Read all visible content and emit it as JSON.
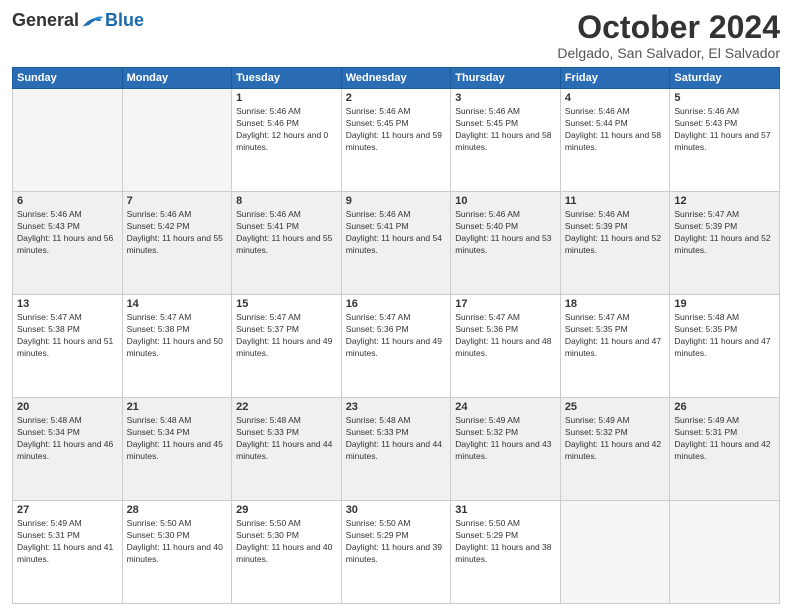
{
  "logo": {
    "general": "General",
    "blue": "Blue"
  },
  "header": {
    "month": "October 2024",
    "location": "Delgado, San Salvador, El Salvador"
  },
  "weekdays": [
    "Sunday",
    "Monday",
    "Tuesday",
    "Wednesday",
    "Thursday",
    "Friday",
    "Saturday"
  ],
  "weeks": [
    [
      {
        "day": "",
        "sunrise": "",
        "sunset": "",
        "daylight": "",
        "empty": true
      },
      {
        "day": "",
        "sunrise": "",
        "sunset": "",
        "daylight": "",
        "empty": true
      },
      {
        "day": "1",
        "sunrise": "Sunrise: 5:46 AM",
        "sunset": "Sunset: 5:46 PM",
        "daylight": "Daylight: 12 hours and 0 minutes."
      },
      {
        "day": "2",
        "sunrise": "Sunrise: 5:46 AM",
        "sunset": "Sunset: 5:45 PM",
        "daylight": "Daylight: 11 hours and 59 minutes."
      },
      {
        "day": "3",
        "sunrise": "Sunrise: 5:46 AM",
        "sunset": "Sunset: 5:45 PM",
        "daylight": "Daylight: 11 hours and 58 minutes."
      },
      {
        "day": "4",
        "sunrise": "Sunrise: 5:46 AM",
        "sunset": "Sunset: 5:44 PM",
        "daylight": "Daylight: 11 hours and 58 minutes."
      },
      {
        "day": "5",
        "sunrise": "Sunrise: 5:46 AM",
        "sunset": "Sunset: 5:43 PM",
        "daylight": "Daylight: 11 hours and 57 minutes."
      }
    ],
    [
      {
        "day": "6",
        "sunrise": "Sunrise: 5:46 AM",
        "sunset": "Sunset: 5:43 PM",
        "daylight": "Daylight: 11 hours and 56 minutes."
      },
      {
        "day": "7",
        "sunrise": "Sunrise: 5:46 AM",
        "sunset": "Sunset: 5:42 PM",
        "daylight": "Daylight: 11 hours and 55 minutes."
      },
      {
        "day": "8",
        "sunrise": "Sunrise: 5:46 AM",
        "sunset": "Sunset: 5:41 PM",
        "daylight": "Daylight: 11 hours and 55 minutes."
      },
      {
        "day": "9",
        "sunrise": "Sunrise: 5:46 AM",
        "sunset": "Sunset: 5:41 PM",
        "daylight": "Daylight: 11 hours and 54 minutes."
      },
      {
        "day": "10",
        "sunrise": "Sunrise: 5:46 AM",
        "sunset": "Sunset: 5:40 PM",
        "daylight": "Daylight: 11 hours and 53 minutes."
      },
      {
        "day": "11",
        "sunrise": "Sunrise: 5:46 AM",
        "sunset": "Sunset: 5:39 PM",
        "daylight": "Daylight: 11 hours and 52 minutes."
      },
      {
        "day": "12",
        "sunrise": "Sunrise: 5:47 AM",
        "sunset": "Sunset: 5:39 PM",
        "daylight": "Daylight: 11 hours and 52 minutes."
      }
    ],
    [
      {
        "day": "13",
        "sunrise": "Sunrise: 5:47 AM",
        "sunset": "Sunset: 5:38 PM",
        "daylight": "Daylight: 11 hours and 51 minutes."
      },
      {
        "day": "14",
        "sunrise": "Sunrise: 5:47 AM",
        "sunset": "Sunset: 5:38 PM",
        "daylight": "Daylight: 11 hours and 50 minutes."
      },
      {
        "day": "15",
        "sunrise": "Sunrise: 5:47 AM",
        "sunset": "Sunset: 5:37 PM",
        "daylight": "Daylight: 11 hours and 49 minutes."
      },
      {
        "day": "16",
        "sunrise": "Sunrise: 5:47 AM",
        "sunset": "Sunset: 5:36 PM",
        "daylight": "Daylight: 11 hours and 49 minutes."
      },
      {
        "day": "17",
        "sunrise": "Sunrise: 5:47 AM",
        "sunset": "Sunset: 5:36 PM",
        "daylight": "Daylight: 11 hours and 48 minutes."
      },
      {
        "day": "18",
        "sunrise": "Sunrise: 5:47 AM",
        "sunset": "Sunset: 5:35 PM",
        "daylight": "Daylight: 11 hours and 47 minutes."
      },
      {
        "day": "19",
        "sunrise": "Sunrise: 5:48 AM",
        "sunset": "Sunset: 5:35 PM",
        "daylight": "Daylight: 11 hours and 47 minutes."
      }
    ],
    [
      {
        "day": "20",
        "sunrise": "Sunrise: 5:48 AM",
        "sunset": "Sunset: 5:34 PM",
        "daylight": "Daylight: 11 hours and 46 minutes."
      },
      {
        "day": "21",
        "sunrise": "Sunrise: 5:48 AM",
        "sunset": "Sunset: 5:34 PM",
        "daylight": "Daylight: 11 hours and 45 minutes."
      },
      {
        "day": "22",
        "sunrise": "Sunrise: 5:48 AM",
        "sunset": "Sunset: 5:33 PM",
        "daylight": "Daylight: 11 hours and 44 minutes."
      },
      {
        "day": "23",
        "sunrise": "Sunrise: 5:48 AM",
        "sunset": "Sunset: 5:33 PM",
        "daylight": "Daylight: 11 hours and 44 minutes."
      },
      {
        "day": "24",
        "sunrise": "Sunrise: 5:49 AM",
        "sunset": "Sunset: 5:32 PM",
        "daylight": "Daylight: 11 hours and 43 minutes."
      },
      {
        "day": "25",
        "sunrise": "Sunrise: 5:49 AM",
        "sunset": "Sunset: 5:32 PM",
        "daylight": "Daylight: 11 hours and 42 minutes."
      },
      {
        "day": "26",
        "sunrise": "Sunrise: 5:49 AM",
        "sunset": "Sunset: 5:31 PM",
        "daylight": "Daylight: 11 hours and 42 minutes."
      }
    ],
    [
      {
        "day": "27",
        "sunrise": "Sunrise: 5:49 AM",
        "sunset": "Sunset: 5:31 PM",
        "daylight": "Daylight: 11 hours and 41 minutes."
      },
      {
        "day": "28",
        "sunrise": "Sunrise: 5:50 AM",
        "sunset": "Sunset: 5:30 PM",
        "daylight": "Daylight: 11 hours and 40 minutes."
      },
      {
        "day": "29",
        "sunrise": "Sunrise: 5:50 AM",
        "sunset": "Sunset: 5:30 PM",
        "daylight": "Daylight: 11 hours and 40 minutes."
      },
      {
        "day": "30",
        "sunrise": "Sunrise: 5:50 AM",
        "sunset": "Sunset: 5:29 PM",
        "daylight": "Daylight: 11 hours and 39 minutes."
      },
      {
        "day": "31",
        "sunrise": "Sunrise: 5:50 AM",
        "sunset": "Sunset: 5:29 PM",
        "daylight": "Daylight: 11 hours and 38 minutes."
      },
      {
        "day": "",
        "sunrise": "",
        "sunset": "",
        "daylight": "",
        "empty": true
      },
      {
        "day": "",
        "sunrise": "",
        "sunset": "",
        "daylight": "",
        "empty": true
      }
    ]
  ]
}
